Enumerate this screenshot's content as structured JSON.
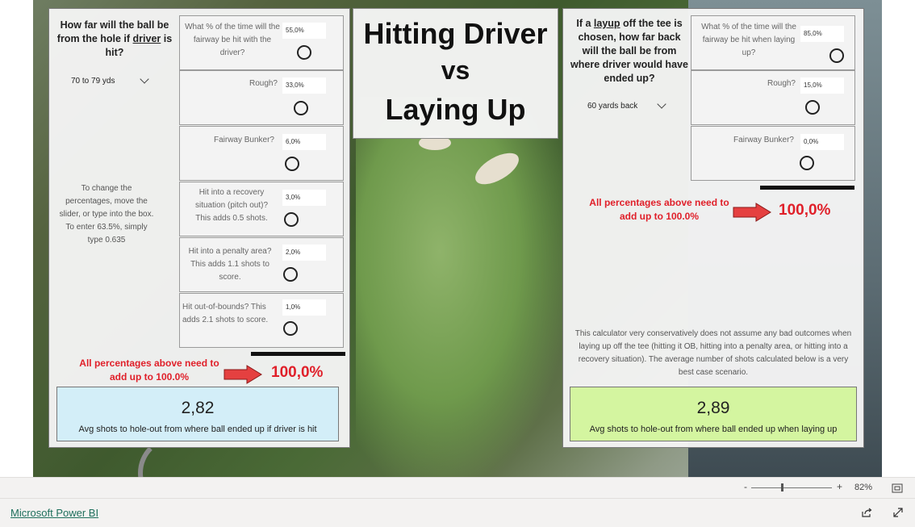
{
  "title": {
    "line1": "Hitting Driver",
    "line2": "vs",
    "line3": "Laying Up"
  },
  "left": {
    "question_pre": "How far will the ball be from the hole if",
    "question_em": "driver",
    "question_post": "is hit?",
    "dropdown_value": "70 to 79 yds",
    "help_text": "To change the percentages, move the slider, or type into the box. To enter 63.5%, simply type 0.635",
    "rows": [
      {
        "label": "What % of the time will the fairway be hit with the driver?",
        "value": "55,0%"
      },
      {
        "label": "Rough?",
        "value": "33,0%"
      },
      {
        "label": "Fairway Bunker?",
        "value": "6,0%"
      },
      {
        "label": "Hit into a recovery situation (pitch out)? This adds 0.5 shots.",
        "value": "3,0%"
      },
      {
        "label": "Hit into a penalty area? This adds 1.1 shots to score.",
        "value": "2,0%"
      },
      {
        "label": "Hit out-of-bounds? This adds 2.1 shots to score.",
        "value": "1,0%"
      }
    ],
    "warning": "All percentages above need to add up to 100.0%",
    "total": "100,0%",
    "result_value": "2,82",
    "result_label": "Avg shots to hole-out from where ball ended up if driver is hit"
  },
  "right": {
    "question_pre": "If a",
    "question_em": "layup",
    "question_post": "off the tee is chosen, how far back will the ball be from where driver would have ended up?",
    "dropdown_value": "60 yards back",
    "rows": [
      {
        "label": "What % of the time will the fairway be hit when laying up?",
        "value": "85,0%"
      },
      {
        "label": "Rough?",
        "value": "15,0%"
      },
      {
        "label": "Fairway Bunker?",
        "value": "0,0%"
      }
    ],
    "warning": "All percentages above need to add up to 100.0%",
    "total": "100,0%",
    "note": "This calculator very conservatively does not assume any bad outcomes when laying up off the tee (hitting it OB, hitting into a penalty area, or hitting into a recovery situation). The average number of shots calculated below is a very best case scenario.",
    "result_value": "2,89",
    "result_label": "Avg shots to hole-out from where ball ended up when laying up"
  },
  "statusbar": {
    "zoom_minus": "-",
    "zoom_plus": "+",
    "zoom_level": "82%"
  },
  "footer": {
    "brand_link": "Microsoft Power BI"
  },
  "colors": {
    "warning_red": "#e0202a",
    "result_left_bg": "#d3eef8",
    "result_right_bg": "#d4f5a0"
  }
}
